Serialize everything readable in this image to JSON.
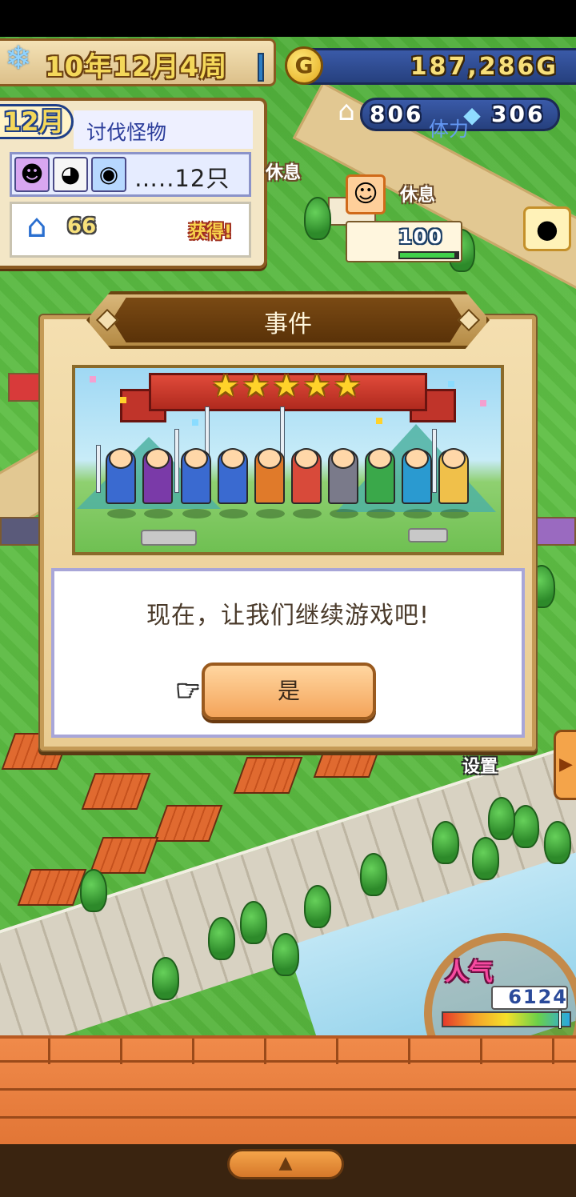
{
  "hud": {
    "date": "10年12月4周",
    "gold": "187,286G",
    "gold_coin_letter": "G",
    "stat_left": "806",
    "stat_right": "306",
    "stamina_label": "体力",
    "rest_label": "休息",
    "power_value": "100",
    "power_level": 0.95
  },
  "quest": {
    "month": "12月",
    "title": "讨伐怪物",
    "count": "…..12只",
    "reward_value": "66",
    "reward_label": "获得!"
  },
  "dialog": {
    "title": "事件",
    "stars": "★★★★★",
    "message": "现在，让我们继续游戏吧!",
    "yes_label": "是"
  },
  "side": {
    "settings_label": "设置"
  },
  "popularity": {
    "label": "人气",
    "value": "6124",
    "level": 0.92
  },
  "icons": {
    "snow": "snowflake-icon",
    "coin": "gold-coin-icon",
    "house": "house-icon",
    "crystal": "crystal-icon",
    "hand": "pointing-hand-icon",
    "potato": "potato-icon",
    "arrow": "up-arrow-icon"
  },
  "colors": {
    "dialog_bg": "#f4dfb0",
    "button": "#f4a45a",
    "hud_blue": "#3a5aa8",
    "brick": "#e27636"
  }
}
